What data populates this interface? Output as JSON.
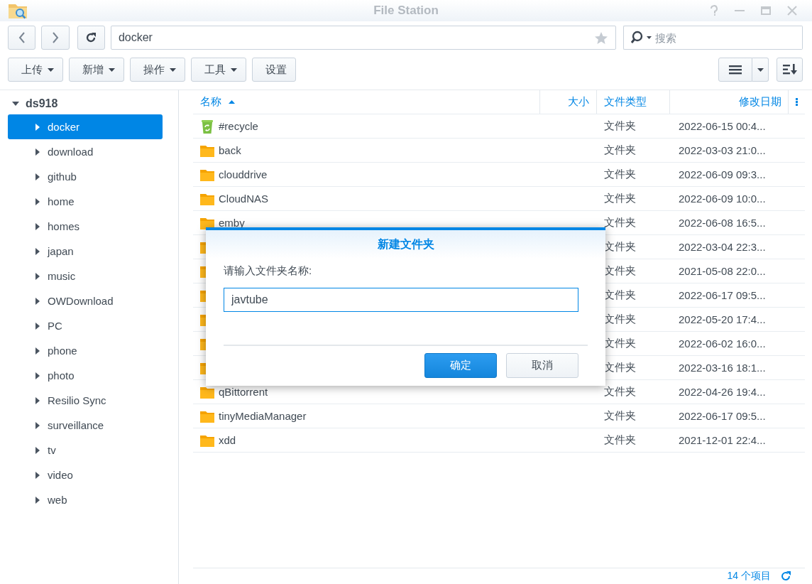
{
  "window": {
    "title": "File Station"
  },
  "path_field": {
    "value": "docker"
  },
  "search": {
    "placeholder": "搜索"
  },
  "toolbar": [
    {
      "label": "上传",
      "kind": "menu"
    },
    {
      "label": "新增",
      "kind": "menu"
    },
    {
      "label": "操作",
      "kind": "menu"
    },
    {
      "label": "工具",
      "kind": "menu"
    },
    {
      "label": "设置",
      "kind": "plain"
    }
  ],
  "sidebar": {
    "root": {
      "label": "ds918",
      "expanded": true,
      "children": [
        {
          "label": "docker",
          "selected": true,
          "expanded": false
        },
        {
          "label": "download",
          "selected": false,
          "expanded": false
        },
        {
          "label": "github",
          "selected": false,
          "expanded": false
        },
        {
          "label": "home",
          "selected": false,
          "expanded": false
        },
        {
          "label": "homes",
          "selected": false,
          "expanded": false
        },
        {
          "label": "japan",
          "selected": false,
          "expanded": false
        },
        {
          "label": "music",
          "selected": false,
          "expanded": false
        },
        {
          "label": "OWDownload",
          "selected": false,
          "expanded": false
        },
        {
          "label": "PC",
          "selected": false,
          "expanded": false
        },
        {
          "label": "phone",
          "selected": false,
          "expanded": false
        },
        {
          "label": "photo",
          "selected": false,
          "expanded": false
        },
        {
          "label": "Resilio Sync",
          "selected": false,
          "expanded": false
        },
        {
          "label": "surveillance",
          "selected": false,
          "expanded": false
        },
        {
          "label": "tv",
          "selected": false,
          "expanded": false
        },
        {
          "label": "video",
          "selected": false,
          "expanded": false
        },
        {
          "label": "web",
          "selected": false,
          "expanded": false
        }
      ]
    }
  },
  "table": {
    "columns": [
      {
        "label": "名称",
        "sorted": true
      },
      {
        "label": "大小",
        "sorted": false
      },
      {
        "label": "文件类型",
        "sorted": false
      },
      {
        "label": "修改日期",
        "sorted": false
      }
    ],
    "rows": [
      {
        "kind": "recycle",
        "name": "#recycle",
        "type": "文件夹",
        "modified": "2022-06-15 00:4..."
      },
      {
        "kind": "folder",
        "name": "back",
        "type": "文件夹",
        "modified": "2022-03-03 21:0..."
      },
      {
        "kind": "folder",
        "name": "clouddrive",
        "type": "文件夹",
        "modified": "2022-06-09 09:3..."
      },
      {
        "kind": "folder",
        "name": "CloudNAS",
        "type": "文件夹",
        "modified": "2022-06-09 10:0..."
      },
      {
        "kind": "folder",
        "name": "emby",
        "type": "文件夹",
        "modified": "2022-06-08 16:5..."
      },
      {
        "kind": "folder",
        "type": "文件夹",
        "modified": "2022-03-04 22:3..."
      },
      {
        "kind": "folder",
        "type": "文件夹",
        "modified": "2021-05-08 22:0..."
      },
      {
        "kind": "folder",
        "type": "文件夹",
        "modified": "2022-06-17 09:5..."
      },
      {
        "kind": "folder",
        "type": "文件夹",
        "modified": "2022-05-20 17:4..."
      },
      {
        "kind": "folder",
        "type": "文件夹",
        "modified": "2022-06-02 16:0..."
      },
      {
        "kind": "folder",
        "type": "文件夹",
        "modified": "2022-03-16 18:1..."
      },
      {
        "kind": "folder",
        "name": "qBittorrent",
        "type": "文件夹",
        "modified": "2022-04-26 19:4..."
      },
      {
        "kind": "folder",
        "name": "tinyMediaManager",
        "type": "文件夹",
        "modified": "2022-06-17 09:5..."
      },
      {
        "kind": "folder",
        "name": "xdd",
        "type": "文件夹",
        "modified": "2021-12-01 22:4..."
      }
    ]
  },
  "status_bar": {
    "count": "14 个项目"
  },
  "dialog": {
    "title": "新建文件夹",
    "prompt": "请输入文件夹名称:",
    "value": "javtube",
    "buttons": [
      {
        "label": "确定",
        "kind": "primary"
      },
      {
        "label": "取消",
        "kind": "secondary"
      }
    ]
  }
}
